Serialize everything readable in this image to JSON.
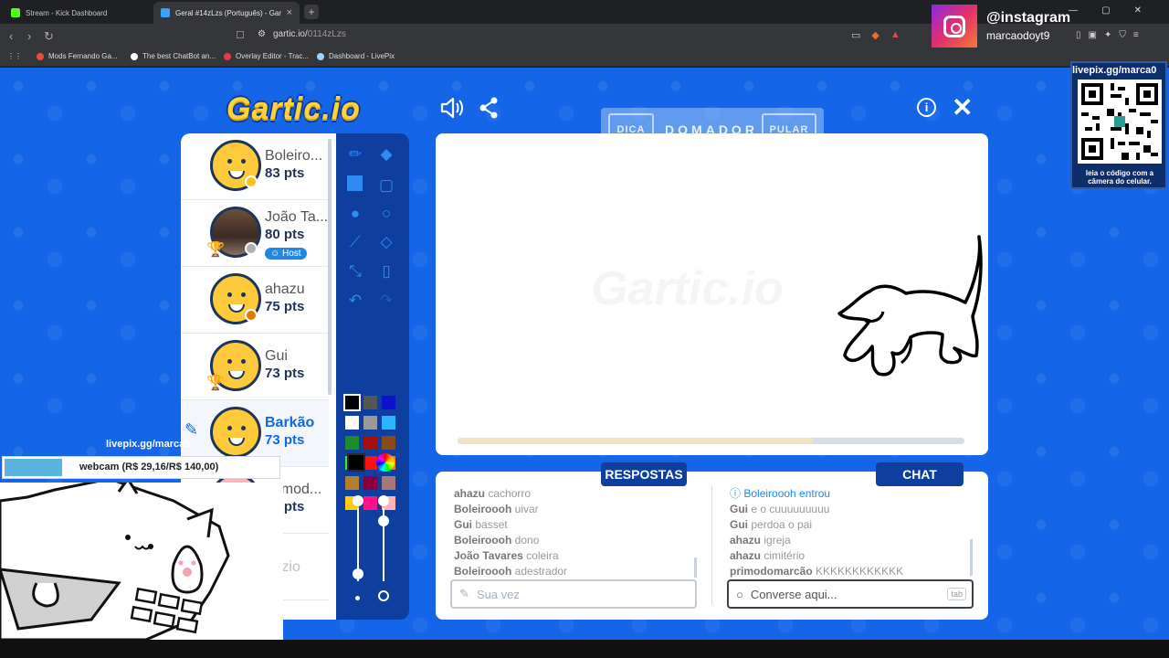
{
  "browser": {
    "tabs": [
      {
        "label": "Stream - Kick Dashboard",
        "color": "#53fc18"
      },
      {
        "label": "Geral #14zLzs (Português) - Gart",
        "color": "#3aa0ff"
      }
    ],
    "url_prefix": "gartic.io/",
    "url_path": "0114zLzs",
    "bookmarks": [
      {
        "label": "Mods Fernando Ga...",
        "color": "#e74c3c"
      },
      {
        "label": "The best ChatBot an...",
        "color": "#ffffff"
      },
      {
        "label": "Overlay Editor - Trac...",
        "color": "#e8384f"
      },
      {
        "label": "Dashboard - LivePix",
        "color": "#9fd3ff"
      }
    ]
  },
  "instagram": {
    "handle": "@instagram",
    "user": "marcaodoyt9"
  },
  "game": {
    "logo": "Gartic.io",
    "hint": {
      "dica": "DICA",
      "word": "DOMADOR",
      "pular": "PULAR"
    },
    "players": [
      {
        "name": "Boleiro...",
        "pts": "83 pts",
        "status_color": "#f5c518",
        "avatar": "smiley"
      },
      {
        "name": "João Ta...",
        "pts": "80 pts",
        "status_color": "#b0b0b0",
        "avatar": "photo",
        "trophy": "2",
        "host": "Host"
      },
      {
        "name": "ahazu",
        "pts": "75 pts",
        "status_color": "#e07b00",
        "avatar": "smiley"
      },
      {
        "name": "Gui",
        "pts": "73 pts",
        "avatar": "smiley",
        "trophy": "1"
      },
      {
        "name": "Barkão",
        "pts": "73 pts",
        "avatar": "smiley",
        "drawing": true
      },
      {
        "name": "primod...",
        "pts": "64 pts",
        "avatar": "pink"
      },
      {
        "name": "Vazio",
        "pts": "",
        "avatar": "empty"
      }
    ],
    "palette": [
      "#000000",
      "#555555",
      "#1010d0",
      "#ffffff",
      "#9a9a9a",
      "#2ab6ff",
      "#1e8a2e",
      "#a01010",
      "#8a4a18",
      "#22ee44",
      "#ff1111",
      "#ff7722",
      "#b08030",
      "#880044",
      "#aa7777",
      "#ffcc11",
      "#ff1188",
      "#ffb0b8"
    ],
    "timer_progress": 0.7,
    "answers": {
      "label": "RESPOSTAS",
      "items": [
        {
          "user": "ahazu",
          "text": "cachorro"
        },
        {
          "user": "Boleiroooh",
          "text": "uivar"
        },
        {
          "user": "Gui",
          "text": "basset"
        },
        {
          "user": "Boleiroooh",
          "text": "dono"
        },
        {
          "user": "João Tavares",
          "text": "coleira"
        },
        {
          "user": "Boleiroooh",
          "text": "adestrador"
        }
      ],
      "placeholder": "Sua vez"
    },
    "chat": {
      "label": "CHAT",
      "system": "Boleiroooh entrou",
      "items": [
        {
          "user": "Gui",
          "text": "e o cuuuuuuuuu"
        },
        {
          "user": "Gui",
          "text": "perdoa o pai"
        },
        {
          "user": "ahazu",
          "text": "igreja"
        },
        {
          "user": "ahazu",
          "text": "cimitério"
        },
        {
          "user": "primodomarcão",
          "text": "KKKKKKKKKKKK"
        }
      ],
      "placeholder": "Converse aqui...",
      "tab_hint": "tab"
    }
  },
  "qr": {
    "url": "livepix.gg/marca0",
    "caption": "leia o código com a câmera do celular."
  },
  "livepix": {
    "url": "livepix.gg/marca0",
    "goal": "webcam (R$ 29,16/R$ 140,00)",
    "progress": 0.21
  }
}
